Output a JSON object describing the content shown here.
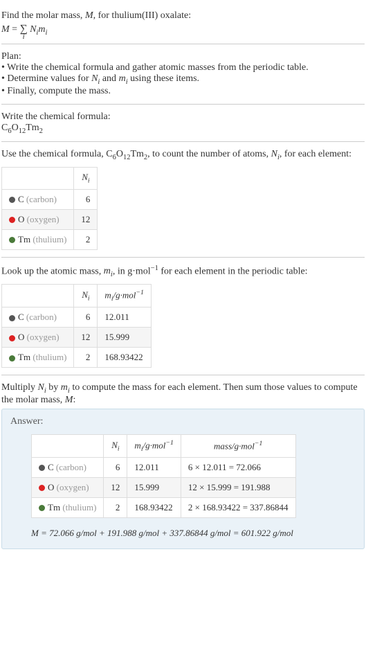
{
  "intro": {
    "line1_prefix": "Find the molar mass, ",
    "line1_var": "M",
    "line1_suffix": ", for thulium(III) oxalate:",
    "eq_lhs": "M",
    "eq_rhs1": "N",
    "eq_rhs2": "m",
    "eq_sub": "i"
  },
  "plan": {
    "title": "Plan:",
    "b1": "• Write the chemical formula and gather atomic masses from the periodic table.",
    "b2_pre": "• Determine values for ",
    "b2_mid": " and ",
    "b2_post": " using these items.",
    "b3": "• Finally, compute the mass."
  },
  "chemformula": {
    "title": "Write the chemical formula:",
    "formula_c": "C",
    "formula_c_n": "6",
    "formula_o": "O",
    "formula_o_n": "12",
    "formula_tm": "Tm",
    "formula_tm_n": "2"
  },
  "count": {
    "pre": "Use the chemical formula, ",
    "post1": ", to count the number of atoms, ",
    "post2": ", for each element:",
    "header_ni": "N",
    "header_ni_sub": "i",
    "rows": [
      {
        "sym": "C",
        "name": "(carbon)",
        "n": "6"
      },
      {
        "sym": "O",
        "name": "(oxygen)",
        "n": "12"
      },
      {
        "sym": "Tm",
        "name": "(thulium)",
        "n": "2"
      }
    ]
  },
  "masses": {
    "pre": "Look up the atomic mass, ",
    "var": "m",
    "sub": "i",
    "mid": ", in g·mol",
    "exp": "−1",
    "post": " for each element in the periodic table:",
    "header_mi": "m",
    "header_mi_unit": "/g·mol",
    "rows": [
      {
        "sym": "C",
        "name": "(carbon)",
        "n": "6",
        "m": "12.011"
      },
      {
        "sym": "O",
        "name": "(oxygen)",
        "n": "12",
        "m": "15.999"
      },
      {
        "sym": "Tm",
        "name": "(thulium)",
        "n": "2",
        "m": "168.93422"
      }
    ]
  },
  "multiply": {
    "text_pre": "Multiply ",
    "text_mid": " by ",
    "text_post1": " to compute the mass for each element. Then sum those values to compute the molar mass, ",
    "text_post2": ":"
  },
  "answer": {
    "label": "Answer:",
    "mass_header": "mass/g·mol",
    "rows": [
      {
        "sym": "C",
        "name": "(carbon)",
        "n": "6",
        "m": "12.011",
        "calc": "6 × 12.011 = 72.066"
      },
      {
        "sym": "O",
        "name": "(oxygen)",
        "n": "12",
        "m": "15.999",
        "calc": "12 × 15.999 = 191.988"
      },
      {
        "sym": "Tm",
        "name": "(thulium)",
        "n": "2",
        "m": "168.93422",
        "calc": "2 × 168.93422 = 337.86844"
      }
    ],
    "final": "M = 72.066 g/mol + 191.988 g/mol + 337.86844 g/mol = 601.922 g/mol"
  }
}
